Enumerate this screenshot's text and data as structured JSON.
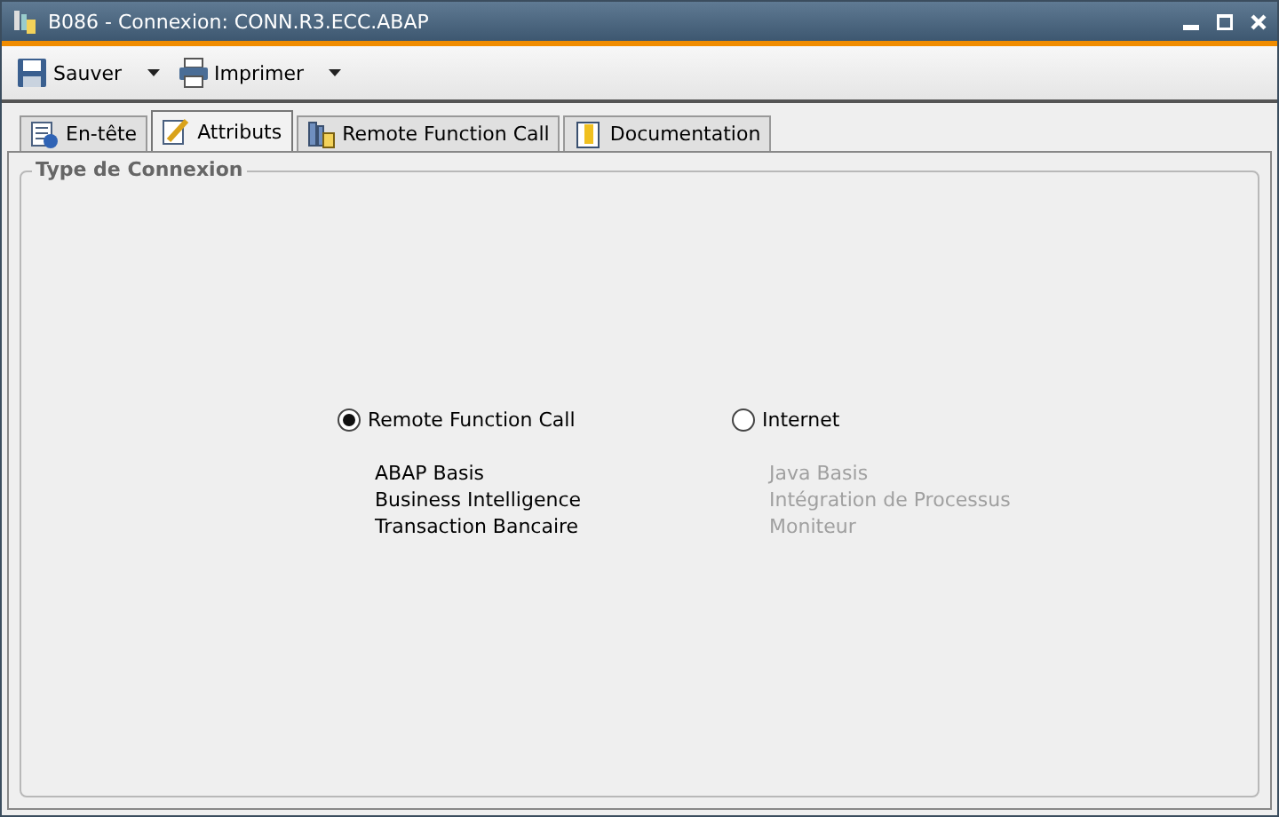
{
  "window": {
    "title": "B086 - Connexion: CONN.R3.ECC.ABAP"
  },
  "toolbar": [
    {
      "label": "Sauver",
      "kind": "save"
    },
    {
      "label": "Imprimer",
      "kind": "print"
    }
  ],
  "tabs": [
    {
      "label": "En-tête",
      "kind": "header",
      "selected": false
    },
    {
      "label": "Attributs",
      "kind": "attributes",
      "selected": true
    },
    {
      "label": "Remote Function Call",
      "kind": "rfc",
      "selected": false
    },
    {
      "label": "Documentation",
      "kind": "doc",
      "selected": false
    }
  ],
  "group": {
    "title": "Type de Connexion",
    "options": [
      {
        "label": "Remote Function Call",
        "selected": true,
        "items": [
          "ABAP Basis",
          "Business Intelligence",
          "Transaction Bancaire"
        ]
      },
      {
        "label": "Internet",
        "selected": false,
        "items": [
          "Java Basis",
          "Intégration de Processus",
          "Moniteur"
        ]
      }
    ]
  }
}
